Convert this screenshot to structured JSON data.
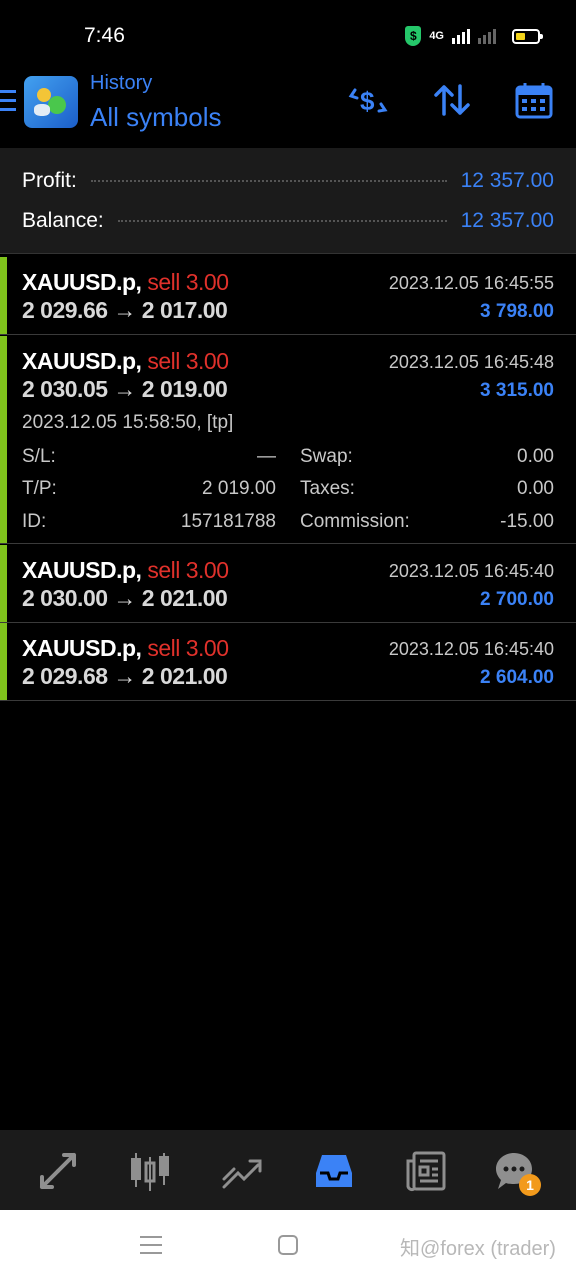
{
  "status_bar": {
    "time": "7:46",
    "network": "4G",
    "icons": [
      "shield-icon",
      "signal-icon",
      "battery-icon"
    ]
  },
  "header": {
    "title": "History",
    "subtitle": "All symbols",
    "actions": [
      "dollar-exchange-icon",
      "sort-icon",
      "calendar-icon"
    ]
  },
  "summary": {
    "profit_label": "Profit:",
    "profit_value": "12 357.00",
    "balance_label": "Balance:",
    "balance_value": "12 357.00"
  },
  "deals": [
    {
      "symbol": "XAUUSD.p,",
      "type": "sell 3.00",
      "prices": "2 029.66 → 2 017.00",
      "datetime": "2023.12.05 16:45:55",
      "profit": "3 798.00"
    },
    {
      "symbol": "XAUUSD.p,",
      "type": "sell 3.00",
      "prices": "2 030.05 → 2 019.00",
      "datetime": "2023.12.05 16:45:48",
      "profit": "3 315.00",
      "details": {
        "open_time": "2023.12.05 15:58:50, [tp]",
        "sl_label": "S/L:",
        "sl_value": "—",
        "tp_label": "T/P:",
        "tp_value": "2 019.00",
        "id_label": "ID:",
        "id_value": "157181788",
        "swap_label": "Swap:",
        "swap_value": "0.00",
        "taxes_label": "Taxes:",
        "taxes_value": "0.00",
        "commission_label": "Commission:",
        "commission_value": "-15.00"
      }
    },
    {
      "symbol": "XAUUSD.p,",
      "type": "sell 3.00",
      "prices": "2 030.00 → 2 021.00",
      "datetime": "2023.12.05 16:45:40",
      "profit": "2 700.00"
    },
    {
      "symbol": "XAUUSD.p,",
      "type": "sell 3.00",
      "prices": "2 029.68 → 2 021.00",
      "datetime": "2023.12.05 16:45:40",
      "profit": "2 604.00"
    }
  ],
  "bottom_nav": {
    "items": [
      "quotes-icon",
      "chart-icon",
      "trade-icon",
      "history-icon",
      "news-icon",
      "chat-icon"
    ],
    "active": "history-icon",
    "chat_badge": "1"
  },
  "watermark": "知@forex (trader)",
  "colors": {
    "accent": "#3b82f6",
    "sell": "#e0312b",
    "profit_bar": "#7fc31c",
    "background": "#000000",
    "panel": "#1b1b1b"
  }
}
